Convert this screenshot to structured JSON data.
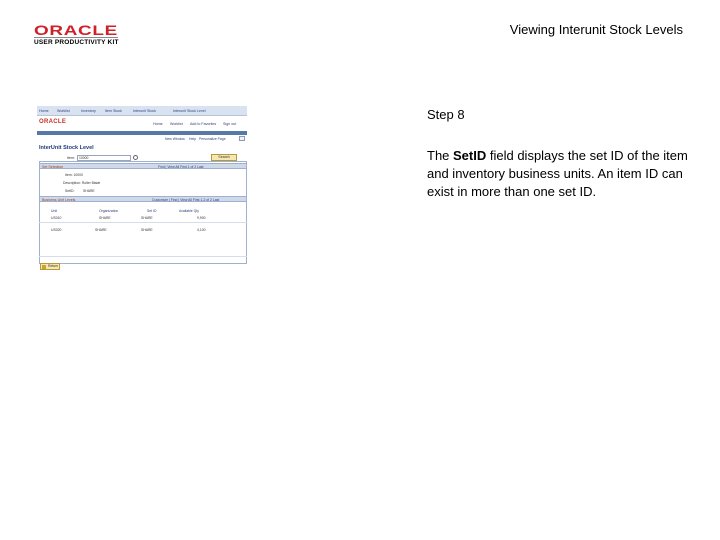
{
  "header": {
    "brand": "ORACLE",
    "brand_sub": "USER PRODUCTIVITY KIT",
    "title": "Viewing Interunit Stock Levels"
  },
  "screenshot": {
    "breadcrumbs": [
      "Home",
      "Worklist",
      "Inventory",
      "Item Stock",
      "Interunit Stock",
      "Interunit Stock Level"
    ],
    "logo": "ORACLE",
    "top_links": [
      "Home",
      "Worklist",
      "Add to Favorites",
      "Sign out"
    ],
    "sub_links": [
      "New Window",
      "Help",
      "Personalize Page"
    ],
    "page_title": "InterUnit Stock Level",
    "item_label": "Item:",
    "item_value": "10000",
    "search_button": "Search",
    "grid1_title": "Set Selection",
    "grid1_right": "Find | View All    First  1 of 2  Last",
    "item_line": "Item: 10000",
    "item_desc": "Description: Roller Blade",
    "setid_label": "SetID:",
    "setid_value": "SHARE",
    "grid2_title": "Business Unit Levels",
    "grid2_right": "Customize | Find | View All    First  1-2 of 2  Last",
    "columns": [
      "Unit",
      "Organization",
      "Set ID",
      "Available Qty"
    ],
    "rows": [
      [
        "US010",
        "SHARE",
        "SHARE",
        "9,900"
      ],
      [
        "US020",
        "SHARE",
        "SHARE",
        "4,100"
      ]
    ],
    "return_button": "Return"
  },
  "step": {
    "label": "Step 8",
    "text_before": "The ",
    "field_name": "SetID",
    "text_after": " field displays the set ID of the item and inventory business units. An item ID can exist in more than one set ID."
  }
}
